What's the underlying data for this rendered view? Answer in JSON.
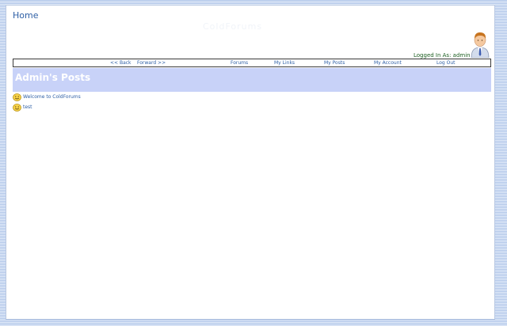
{
  "header": {
    "home_label": "Home",
    "watermark_text": "ColdForums",
    "logged_in_text": "Logged In As: admin"
  },
  "nav": {
    "back": "<< Back",
    "forward": "Forward >>",
    "forums": "Forums",
    "my_links": "My Links",
    "my_posts": "My Posts",
    "my_account": "My Account",
    "log_out": "Log Out"
  },
  "main": {
    "title": "Admin's Posts",
    "posts": [
      {
        "title": "Welcome to ColdForums",
        "icon": "smiley-icon"
      },
      {
        "title": "test",
        "icon": "smiley-icon"
      }
    ]
  },
  "colors": {
    "link": "#2e5fa5",
    "title_band": "#c8d2f8",
    "logged_in": "#1b5e20"
  }
}
